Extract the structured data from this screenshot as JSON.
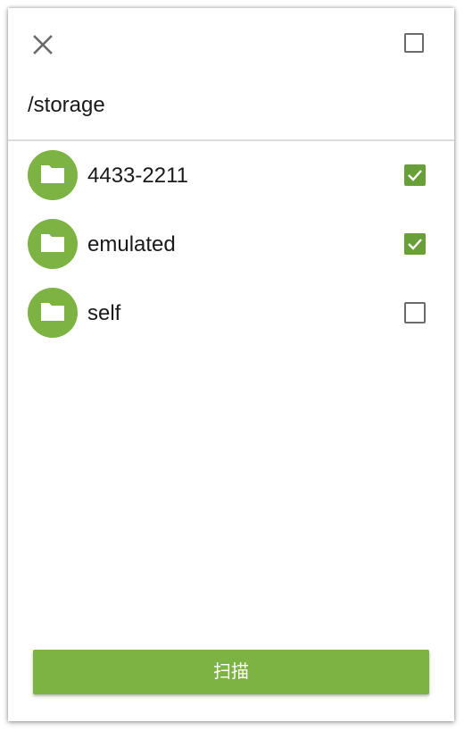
{
  "header": {
    "close_icon": "close-icon",
    "select_all_checked": false,
    "path": "/storage"
  },
  "folders": [
    {
      "name": "4433-2211",
      "icon": "folder-icon",
      "checked": true
    },
    {
      "name": "emulated",
      "icon": "folder-icon",
      "checked": true
    },
    {
      "name": "self",
      "icon": "folder-icon",
      "checked": false
    }
  ],
  "scan_button": {
    "label": "扫描"
  },
  "colors": {
    "accent": "#7cb342",
    "checkbox_checked": "#689f38",
    "checkbox_unchecked_border": "#6b6b6b"
  }
}
